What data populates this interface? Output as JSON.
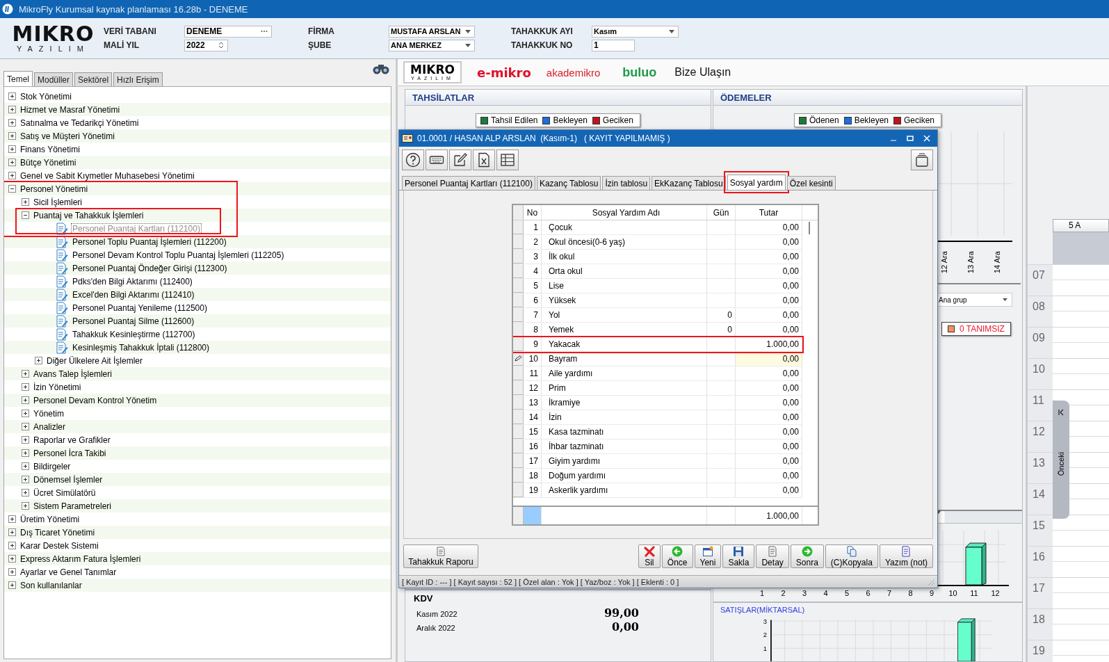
{
  "window": {
    "title": "MikroFly Kurumsal kaynak planlaması 16.28b - DENEME"
  },
  "header": {
    "logo": {
      "name": "MIKRO",
      "tagline": "YAZILIM"
    },
    "fields": [
      {
        "label": "VERİ TABANI",
        "value": "DENEME",
        "kind": "browse"
      },
      {
        "label": "MALİ YIL",
        "value": "2022",
        "kind": "spin"
      },
      {
        "label": "FİRMA",
        "value": "MUSTAFA ARSLAN",
        "kind": "dropdown"
      },
      {
        "label": "ŞUBE",
        "value": "ANA MERKEZ",
        "kind": "dropdown"
      },
      {
        "label": "TAHAKKUK AYI",
        "value": "Kasım",
        "kind": "dropdown"
      },
      {
        "label": "TAHAKKUK NO",
        "value": "1",
        "kind": "text"
      }
    ]
  },
  "sidebar": {
    "tabs": [
      {
        "label": "Temel",
        "selected": true
      },
      {
        "label": "Modüller",
        "selected": false
      },
      {
        "label": "Sektörel",
        "selected": false
      },
      {
        "label": "Hızlı Erişim",
        "selected": false
      }
    ],
    "tree": [
      {
        "label": "Stok Yönetimi",
        "kind": "group",
        "expanded": false,
        "selected": false
      },
      {
        "label": "Hizmet ve Masraf Yönetimi",
        "kind": "group",
        "expanded": false,
        "selected": false
      },
      {
        "label": "Satınalma ve Tedarikçi Yönetimi",
        "kind": "group",
        "expanded": false,
        "selected": false
      },
      {
        "label": "Satış ve Müşteri Yönetimi",
        "kind": "group",
        "expanded": false,
        "selected": false
      },
      {
        "label": "Finans Yönetimi",
        "kind": "group",
        "expanded": false,
        "selected": false
      },
      {
        "label": "Bütçe Yönetimi",
        "kind": "group",
        "expanded": false,
        "selected": false
      },
      {
        "label": "Genel ve Sabit Kıymetler Muhasebesi Yönetimi",
        "kind": "group",
        "expanded": false,
        "selected": false
      },
      {
        "label": "Personel Yönetimi",
        "kind": "group",
        "expanded": true,
        "selected": false,
        "children": [
          {
            "label": "Sicil İşlemleri",
            "kind": "group",
            "expanded": false,
            "selected": false
          },
          {
            "label": "Puantaj ve Tahakkuk İşlemleri",
            "kind": "group",
            "expanded": true,
            "selected": false,
            "children": [
              {
                "label": "Personel Puantaj Kartları (112100)",
                "kind": "page",
                "selected": true
              },
              {
                "label": "Personel Toplu Puantaj İşlemleri (112200)",
                "kind": "page",
                "selected": false
              },
              {
                "label": "Personel Devam Kontrol Toplu Puantaj İşlemleri (112205)",
                "kind": "page",
                "selected": false
              },
              {
                "label": "Personel Puantaj Öndeğer Girişi (112300)",
                "kind": "page",
                "selected": false
              },
              {
                "label": "Pdks'den Bilgi Aktarımı (112400)",
                "kind": "page",
                "selected": false
              },
              {
                "label": "Excel'den Bilgi Aktarımı (112410)",
                "kind": "page",
                "selected": false
              },
              {
                "label": "Personel Puantaj Yenileme (112500)",
                "kind": "page",
                "selected": false
              },
              {
                "label": "Personel Puantaj Silme (112600)",
                "kind": "page",
                "selected": false
              },
              {
                "label": "Tahakkuk Kesinleştirme (112700)",
                "kind": "page",
                "selected": false
              },
              {
                "label": "Kesinleşmiş Tahakkuk İptali (112800)",
                "kind": "page",
                "selected": false
              },
              {
                "label": "Diğer Ülkelere Ait İşlemler",
                "kind": "group",
                "expanded": false,
                "selected": false
              }
            ]
          },
          {
            "label": "Avans Talep İşlemleri",
            "kind": "group",
            "expanded": false,
            "selected": false
          },
          {
            "label": "İzin Yönetimi",
            "kind": "group",
            "expanded": false,
            "selected": false
          },
          {
            "label": "Personel Devam Kontrol Yönetim",
            "kind": "group",
            "expanded": false,
            "selected": false
          },
          {
            "label": "Yönetim",
            "kind": "group",
            "expanded": false,
            "selected": false
          },
          {
            "label": "Analizler",
            "kind": "group",
            "expanded": false,
            "selected": false
          },
          {
            "label": "Raporlar ve Grafikler",
            "kind": "group",
            "expanded": false,
            "selected": false
          },
          {
            "label": "Personel İcra Takibi",
            "kind": "group",
            "expanded": false,
            "selected": false
          },
          {
            "label": "Bildirgeler",
            "kind": "group",
            "expanded": false,
            "selected": false
          },
          {
            "label": "Dönemsel İşlemler",
            "kind": "group",
            "expanded": false,
            "selected": false
          },
          {
            "label": "Ücret Simülatörü",
            "kind": "group",
            "expanded": false,
            "selected": false
          },
          {
            "label": "Sistem Parametreleri",
            "kind": "group",
            "expanded": false,
            "selected": false
          }
        ]
      },
      {
        "label": "Üretim Yönetimi",
        "kind": "group",
        "expanded": false,
        "selected": false
      },
      {
        "label": "Dış Ticaret Yönetimi",
        "kind": "group",
        "expanded": false,
        "selected": false
      },
      {
        "label": "Karar Destek Sistemi",
        "kind": "group",
        "expanded": false,
        "selected": false
      },
      {
        "label": "Express Aktarım Fatura İşlemleri",
        "kind": "group",
        "expanded": false,
        "selected": false
      },
      {
        "label": "Ayarlar ve Genel Tanımlar",
        "kind": "group",
        "expanded": false,
        "selected": false
      },
      {
        "label": "Son kullanılanlar",
        "kind": "group",
        "expanded": false,
        "selected": false
      }
    ]
  },
  "banner": {
    "logo": {
      "name": "MIKRO",
      "tagline": "YAZILIM"
    },
    "links": [
      {
        "label": "e-mikro",
        "kind": "emikro"
      },
      {
        "label": "akademikro",
        "kind": "akademi"
      },
      {
        "label": "buluo",
        "kind": "buluo"
      },
      {
        "label": "Bize Ulaşın",
        "kind": "contact"
      }
    ]
  },
  "dashboard": {
    "tahsilatlar": {
      "title": "TAHSİLATLAR",
      "legend": [
        {
          "label": "Tahsil Edilen",
          "color": "#1e7a3c"
        },
        {
          "label": "Bekleyen",
          "color": "#1f6fd8"
        },
        {
          "label": "Geciken",
          "color": "#c0141c"
        }
      ]
    },
    "odemeler": {
      "title": "ÖDEMELER",
      "legend": [
        {
          "label": "Ödenen",
          "color": "#1e7a3c"
        },
        {
          "label": "Bekleyen",
          "color": "#1f6fd8"
        },
        {
          "label": "Geciken",
          "color": "#c0141c"
        }
      ],
      "date_labels": [
        "12 Ara",
        "13 Ara",
        "14 Ara"
      ],
      "group_select": "Ana grup",
      "group_legend": [
        {
          "label": "0 TANIMSIZ",
          "color": "#f4925a"
        }
      ],
      "month_labels": [
        "1",
        "2",
        "3",
        "4",
        "5",
        "6",
        "7",
        "8",
        "9",
        "10",
        "11",
        "12"
      ]
    },
    "kdv": {
      "title": "KDV",
      "rows": [
        {
          "label": "Kasım 2022",
          "value": "99,00"
        },
        {
          "label": "Aralık 2022",
          "value": "0,00"
        }
      ]
    },
    "sales": {
      "title": "SATIŞLAR(MİKTARSAL)",
      "y_labels": [
        "3",
        "2",
        "1"
      ]
    }
  },
  "calendar": {
    "day_header": "5 A",
    "hours": [
      "07",
      "08",
      "09",
      "10",
      "11",
      "12",
      "13",
      "14",
      "15",
      "16",
      "17",
      "18",
      "19"
    ],
    "prev_tab": "Önceki"
  },
  "dialog": {
    "title": "01.0001 / HASAN ALP ARSLAN  (Kasım-1)   ( KAYIT YAPILMAMIŞ )",
    "tabs": [
      {
        "label": "Personel Puantaj Kartları (112100)",
        "selected": false,
        "annotated": false
      },
      {
        "label": "Kazanç Tablosu",
        "selected": false,
        "annotated": false
      },
      {
        "label": "İzin tablosu",
        "selected": false,
        "annotated": false
      },
      {
        "label": "EkKazanç Tablosu",
        "selected": false,
        "annotated": false
      },
      {
        "label": "Sosyal yardım",
        "selected": true,
        "annotated": true
      },
      {
        "label": "Özel kesinti",
        "selected": false,
        "annotated": false
      }
    ],
    "table": {
      "columns": [
        "No",
        "Sosyal Yardım Adı",
        "Gün",
        "Tutar"
      ],
      "rows": [
        {
          "no": "1",
          "name": "Çocuk",
          "days": "",
          "amount": "0,00",
          "selected": false,
          "annotated": false
        },
        {
          "no": "2",
          "name": "Okul öncesi(0-6 yaş)",
          "days": "",
          "amount": "0,00",
          "selected": false,
          "annotated": false
        },
        {
          "no": "3",
          "name": "İlk okul",
          "days": "",
          "amount": "0,00",
          "selected": false,
          "annotated": false
        },
        {
          "no": "4",
          "name": "Orta okul",
          "days": "",
          "amount": "0,00",
          "selected": false,
          "annotated": false
        },
        {
          "no": "5",
          "name": "Lise",
          "days": "",
          "amount": "0,00",
          "selected": false,
          "annotated": false
        },
        {
          "no": "6",
          "name": "Yüksek",
          "days": "",
          "amount": "0,00",
          "selected": false,
          "annotated": false
        },
        {
          "no": "7",
          "name": "Yol",
          "days": "0",
          "amount": "0,00",
          "selected": false,
          "annotated": false
        },
        {
          "no": "8",
          "name": "Yemek",
          "days": "0",
          "amount": "0,00",
          "selected": false,
          "annotated": false
        },
        {
          "no": "9",
          "name": "Yakacak",
          "days": "",
          "amount": "1.000,00",
          "selected": false,
          "annotated": true
        },
        {
          "no": "10",
          "name": "Bayram",
          "days": "",
          "amount": "0,00",
          "selected": true,
          "annotated": false
        },
        {
          "no": "11",
          "name": "Aile yardımı",
          "days": "",
          "amount": "0,00",
          "selected": false,
          "annotated": false
        },
        {
          "no": "12",
          "name": "Prim",
          "days": "",
          "amount": "0,00",
          "selected": false,
          "annotated": false
        },
        {
          "no": "13",
          "name": "İkramiye",
          "days": "",
          "amount": "0,00",
          "selected": false,
          "annotated": false
        },
        {
          "no": "14",
          "name": "İzin",
          "days": "",
          "amount": "0,00",
          "selected": false,
          "annotated": false
        },
        {
          "no": "15",
          "name": "Kasa tazminatı",
          "days": "",
          "amount": "0,00",
          "selected": false,
          "annotated": false
        },
        {
          "no": "16",
          "name": "İhbar tazminatı",
          "days": "",
          "amount": "0,00",
          "selected": false,
          "annotated": false
        },
        {
          "no": "17",
          "name": "Giyim yardımı",
          "days": "",
          "amount": "0,00",
          "selected": false,
          "annotated": false
        },
        {
          "no": "18",
          "name": "Doğum yardımı",
          "days": "",
          "amount": "0,00",
          "selected": false,
          "annotated": false
        },
        {
          "no": "19",
          "name": "Askerlik yardımı",
          "days": "",
          "amount": "0,00",
          "selected": false,
          "annotated": false
        }
      ],
      "total": "1.000,00"
    },
    "report_button": "Tahakkuk Raporu",
    "buttons": [
      {
        "label": "Sil",
        "kind": "delete"
      },
      {
        "label": "Önce",
        "kind": "prev"
      },
      {
        "label": "Yeni",
        "kind": "new"
      },
      {
        "label": "Sakla",
        "kind": "save"
      },
      {
        "label": "Detay",
        "kind": "detail"
      },
      {
        "label": "Sonra",
        "kind": "next"
      },
      {
        "label": "(C)Kopyala",
        "kind": "copy"
      },
      {
        "label": "Yazım (not)",
        "kind": "note"
      }
    ],
    "status": "[ Kayıt ID : --- ] [ Kayıt sayısı : 52 ] [ Özel alan : Yok ] [ Yaz/boz : Yok ] [ Eklenti : 0 ]"
  }
}
